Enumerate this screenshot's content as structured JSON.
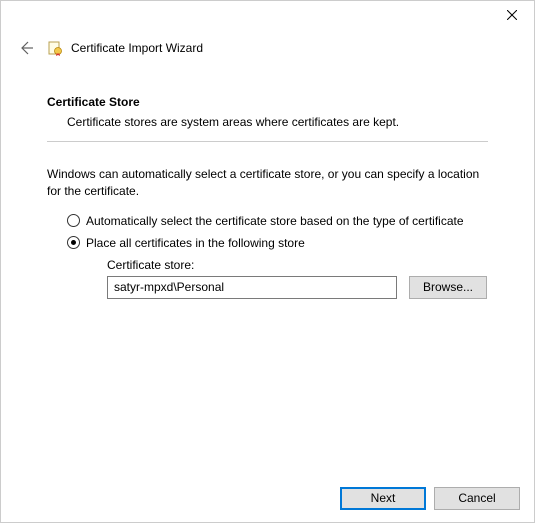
{
  "header": {
    "title": "Certificate Import Wizard"
  },
  "section": {
    "title": "Certificate Store",
    "description": "Certificate stores are system areas where certificates are kept."
  },
  "body": {
    "intro": "Windows can automatically select a certificate store, or you can specify a location for the certificate.",
    "radio_auto": "Automatically select the certificate store based on the type of certificate",
    "radio_place": "Place all certificates in the following store",
    "store_label": "Certificate store:",
    "store_value": "satyr-mpxd\\Personal",
    "browse_label": "Browse..."
  },
  "footer": {
    "next_label": "Next",
    "cancel_label": "Cancel"
  }
}
